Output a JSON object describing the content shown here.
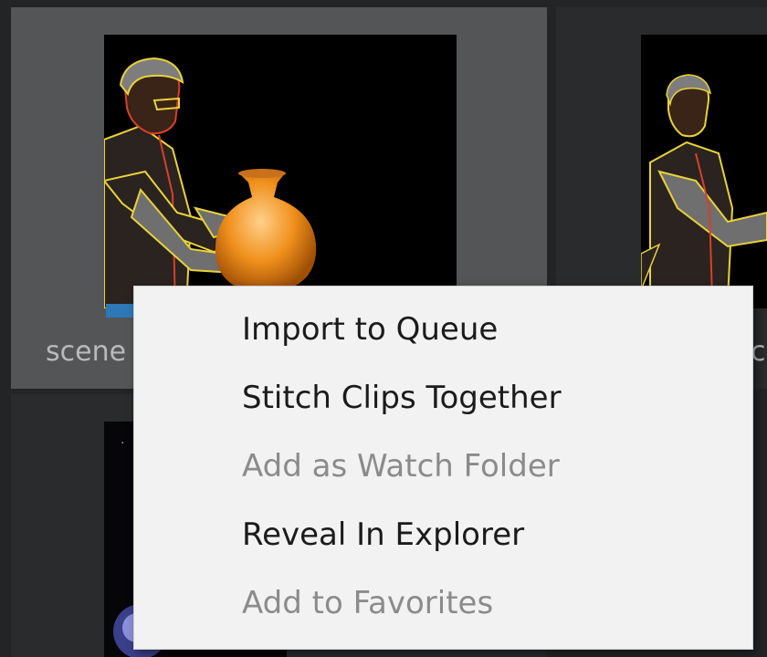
{
  "thumbnails": [
    {
      "clip_name": "scene",
      "progress": 0.1,
      "selected": true
    },
    {
      "clip_name": "c",
      "selected": false
    },
    {
      "selected": false
    }
  ],
  "context_menu": {
    "items": [
      {
        "label": "Import to Queue",
        "enabled": true
      },
      {
        "label": "Stitch Clips Together",
        "enabled": true
      },
      {
        "label": "Add as Watch Folder",
        "enabled": false
      },
      {
        "label": "Reveal In Explorer",
        "enabled": true
      },
      {
        "label": "Add to Favorites",
        "enabled": false
      }
    ]
  },
  "colors": {
    "background": "#232425",
    "selected_tile": "#545556",
    "menu_background": "#f2f2f2",
    "menu_text": "#1b1b1b",
    "menu_text_disabled": "#8b8b8b",
    "progress": "#2e78b7"
  }
}
